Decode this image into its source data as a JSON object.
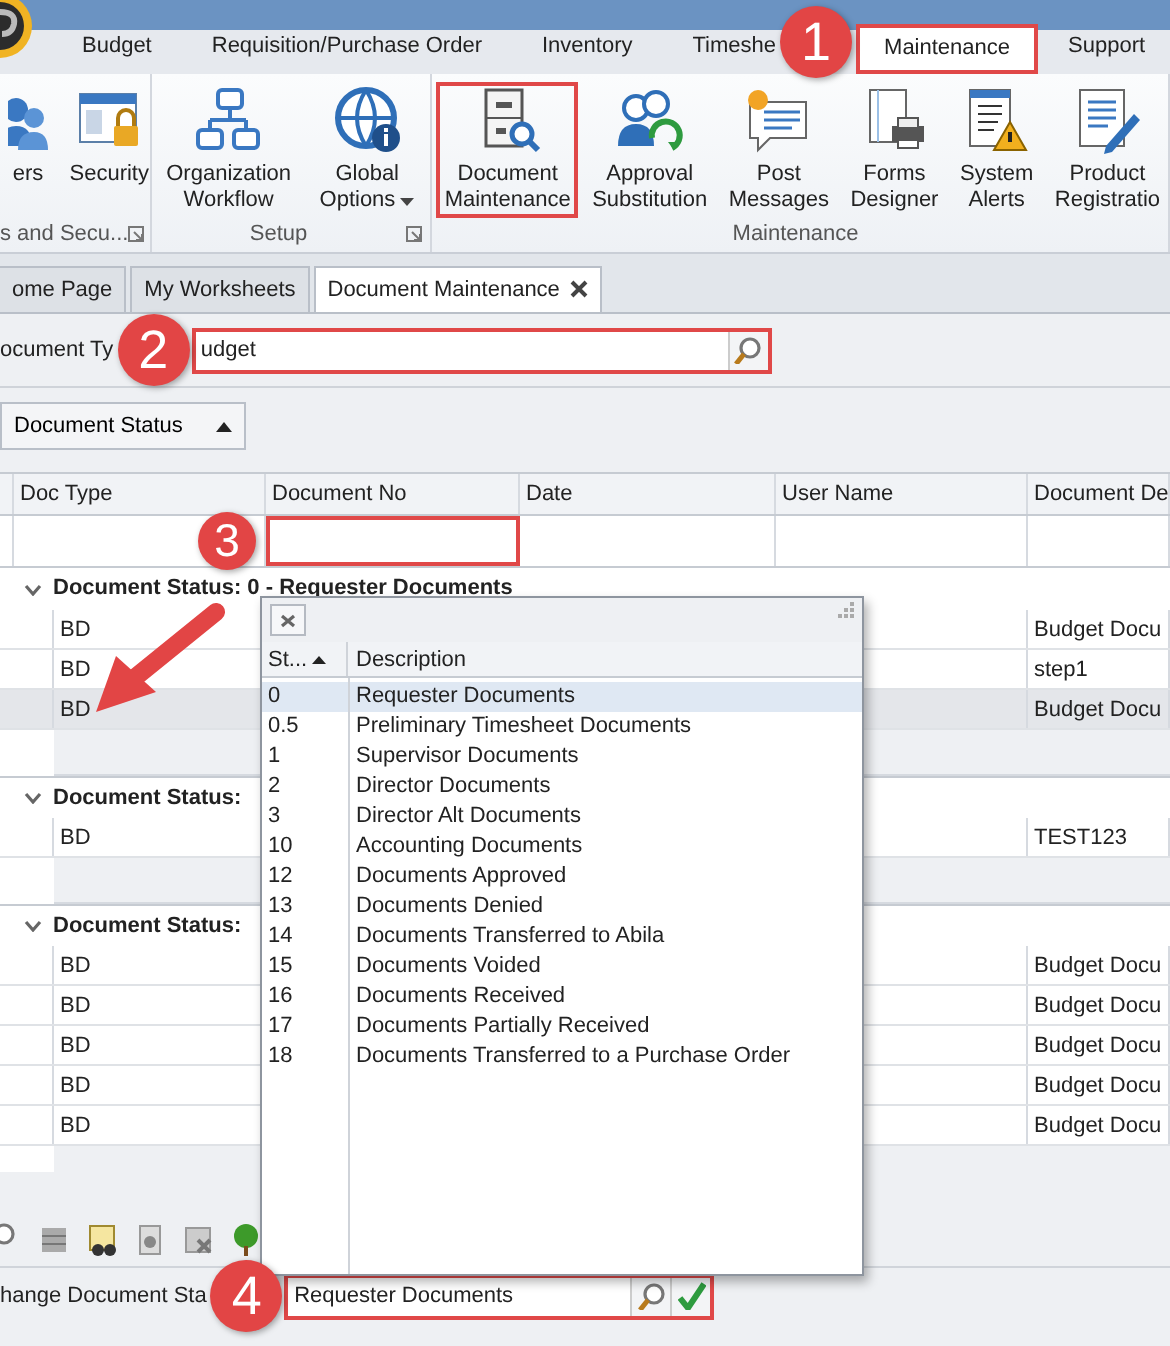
{
  "ribbon_tabs": [
    {
      "label": "Budget",
      "selected": false
    },
    {
      "label": "Requisition/Purchase Order",
      "selected": false
    },
    {
      "label": "Inventory",
      "selected": false
    },
    {
      "label": "Timeshe",
      "selected": false
    },
    {
      "label": "Maintenance",
      "selected": true
    },
    {
      "label": "Support",
      "selected": false
    }
  ],
  "ribbon_groups": [
    {
      "label": "s and Secu...",
      "launcher": true,
      "buttons": [
        {
          "lines": [
            "ers"
          ],
          "dropdown": false,
          "highlighted": false
        },
        {
          "lines": [
            "Security"
          ],
          "dropdown": false,
          "highlighted": false
        }
      ]
    },
    {
      "label": "Setup",
      "launcher": true,
      "buttons": [
        {
          "lines": [
            "Organization",
            "Workflow"
          ],
          "dropdown": false,
          "highlighted": false
        },
        {
          "lines": [
            "Global",
            "Options"
          ],
          "dropdown": true,
          "highlighted": false
        }
      ]
    },
    {
      "label": "Maintenance",
      "launcher": false,
      "buttons": [
        {
          "lines": [
            "Document",
            "Maintenance"
          ],
          "dropdown": false,
          "highlighted": true
        },
        {
          "lines": [
            "Approval",
            "Substitution"
          ],
          "dropdown": false,
          "highlighted": false
        },
        {
          "lines": [
            "Post",
            "Messages"
          ],
          "dropdown": false,
          "highlighted": false
        },
        {
          "lines": [
            "Forms",
            "Designer"
          ],
          "dropdown": false,
          "highlighted": false
        },
        {
          "lines": [
            "System",
            "Alerts"
          ],
          "dropdown": false,
          "highlighted": false
        },
        {
          "lines": [
            "Product",
            "Registratio"
          ],
          "dropdown": false,
          "highlighted": false
        }
      ]
    }
  ],
  "doc_tabs": [
    {
      "label": "ome Page",
      "selected": false,
      "closable": false
    },
    {
      "label": "My Worksheets",
      "selected": false,
      "closable": false
    },
    {
      "label": "Document Maintenance",
      "selected": true,
      "closable": true
    }
  ],
  "document_type": {
    "label": "ocument Ty",
    "value": "udget"
  },
  "group_by": {
    "label": "Document Status"
  },
  "grid": {
    "columns": [
      "Doc Type",
      "Document No",
      "Date",
      "User Name",
      "Document De"
    ],
    "groups": [
      {
        "header": "Document Status: 0 - Requester Documents",
        "expanded": true,
        "rows": [
          {
            "doc_type": "BD",
            "description": "Budget Docu",
            "selected": false
          },
          {
            "doc_type": "BD",
            "description": "step1",
            "selected": false
          },
          {
            "doc_type": "BD",
            "description": "Budget Docu",
            "selected": true
          }
        ]
      },
      {
        "header": "Document Status:",
        "expanded": true,
        "rows": [
          {
            "doc_type": "BD",
            "description": "TEST123",
            "selected": false
          }
        ]
      },
      {
        "header": "Document Status:",
        "expanded": true,
        "rows": [
          {
            "doc_type": "BD",
            "description": "Budget Docu",
            "selected": false
          },
          {
            "doc_type": "BD",
            "description": "Budget Docu",
            "selected": false
          },
          {
            "doc_type": "BD",
            "description": "Budget Docu",
            "selected": false
          },
          {
            "doc_type": "BD",
            "description": "Budget Docu",
            "selected": false
          },
          {
            "doc_type": "BD",
            "description": "Budget Docu",
            "selected": false
          }
        ]
      }
    ]
  },
  "status_popup": {
    "columns": [
      "St...",
      "Description"
    ],
    "rows": [
      {
        "status": "0",
        "description": "Requester Documents",
        "selected": true
      },
      {
        "status": "0.5",
        "description": "Preliminary Timesheet Documents",
        "selected": false
      },
      {
        "status": "1",
        "description": "Supervisor Documents",
        "selected": false
      },
      {
        "status": "2",
        "description": "Director Documents",
        "selected": false
      },
      {
        "status": "3",
        "description": "Director Alt Documents",
        "selected": false
      },
      {
        "status": "10",
        "description": "Accounting Documents",
        "selected": false
      },
      {
        "status": "12",
        "description": "Documents Approved",
        "selected": false
      },
      {
        "status": "13",
        "description": "Documents Denied",
        "selected": false
      },
      {
        "status": "14",
        "description": "Documents Transferred to Abila",
        "selected": false
      },
      {
        "status": "15",
        "description": "Documents Voided",
        "selected": false
      },
      {
        "status": "16",
        "description": "Documents Received",
        "selected": false
      },
      {
        "status": "17",
        "description": "Documents Partially Received",
        "selected": false
      },
      {
        "status": "18",
        "description": "Documents Transferred to a Purchase Order",
        "selected": false
      }
    ]
  },
  "change_status": {
    "label": "hange Document Sta",
    "value": "Requester Documents"
  },
  "callouts": [
    "1",
    "2",
    "3",
    "4"
  ]
}
